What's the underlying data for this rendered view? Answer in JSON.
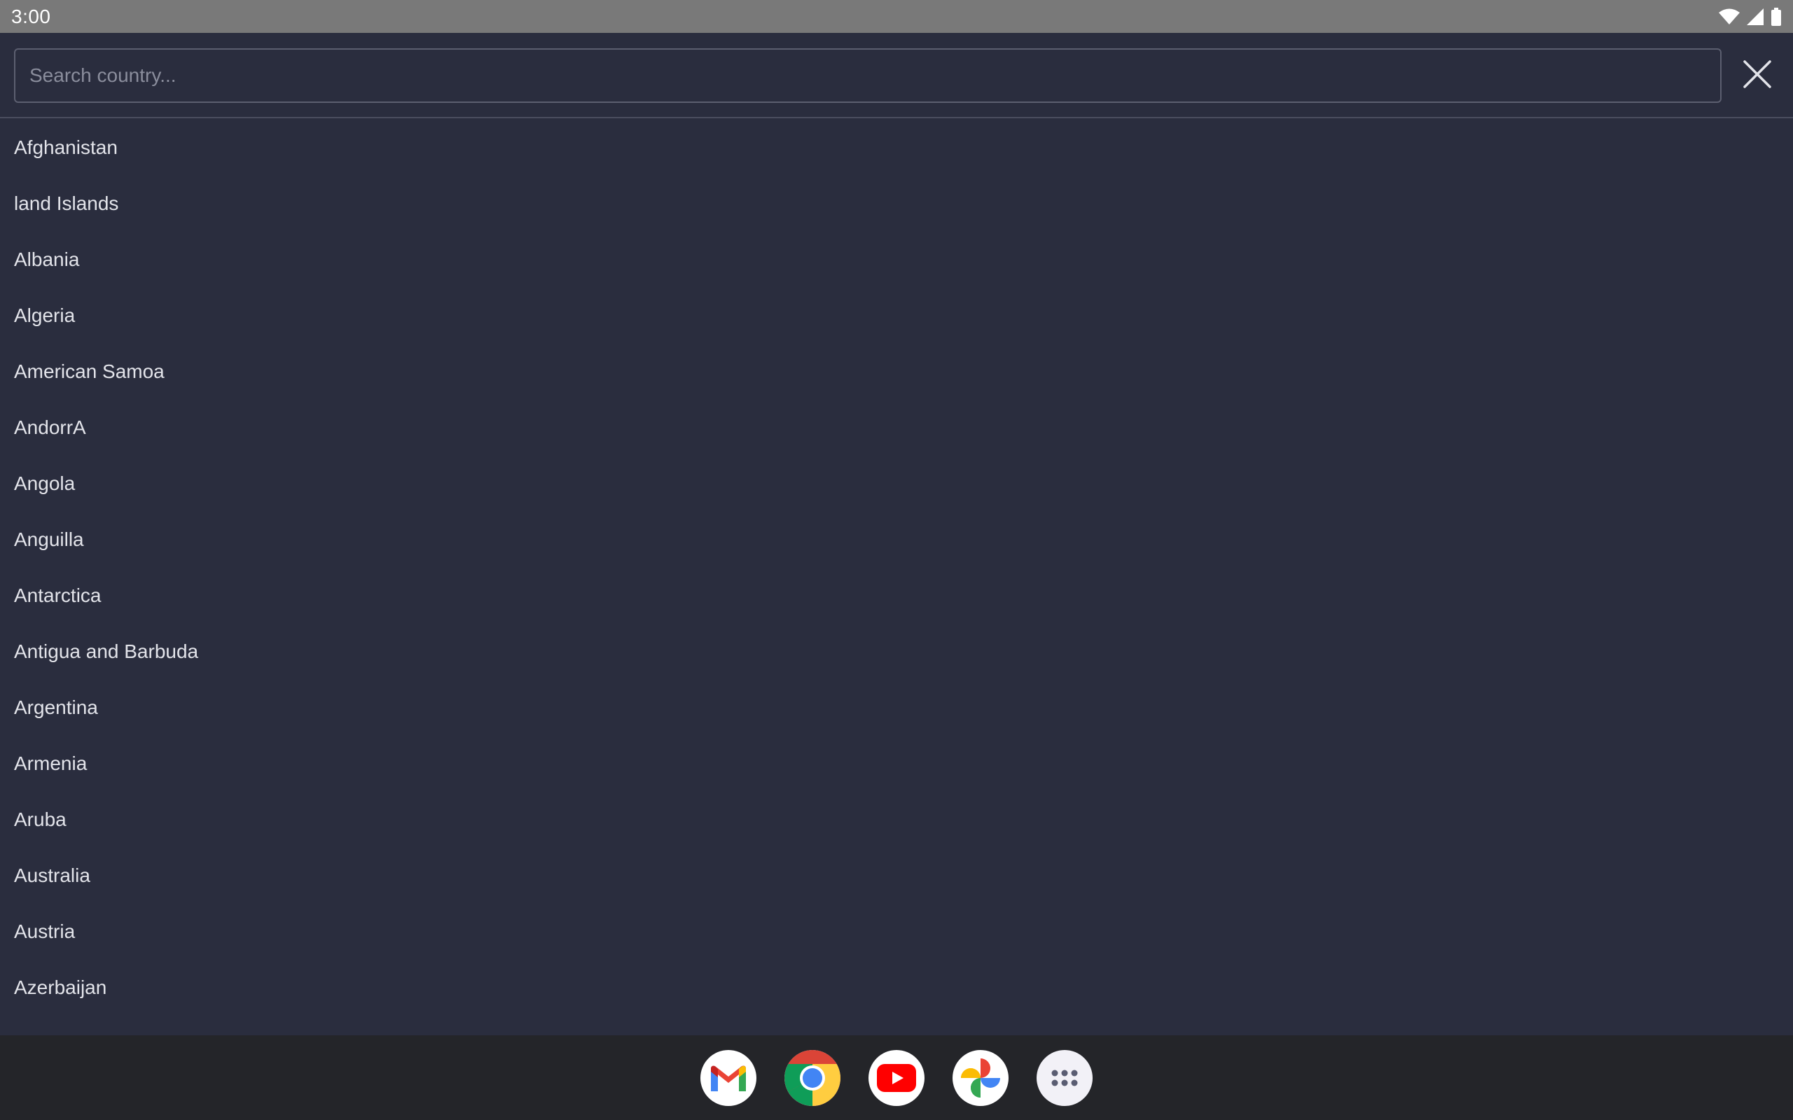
{
  "status_bar": {
    "time": "3:00",
    "icons": [
      "wifi-icon",
      "signal-icon",
      "battery-icon"
    ]
  },
  "search": {
    "placeholder": "Search country...",
    "value": ""
  },
  "countries": [
    "Afghanistan",
    "land Islands",
    "Albania",
    "Algeria",
    "American Samoa",
    "AndorrA",
    "Angola",
    "Anguilla",
    "Antarctica",
    "Antigua and Barbuda",
    "Argentina",
    "Armenia",
    "Aruba",
    "Australia",
    "Austria",
    "Azerbaijan"
  ],
  "dock": {
    "apps": [
      "gmail-icon",
      "chrome-icon",
      "youtube-icon",
      "photos-icon",
      "app-drawer-icon"
    ]
  },
  "colors": {
    "background": "#2a2d3e",
    "status_bar": "#797979",
    "dock": "#242529",
    "text": "#e3e4ea",
    "placeholder": "#8a8d9c"
  }
}
